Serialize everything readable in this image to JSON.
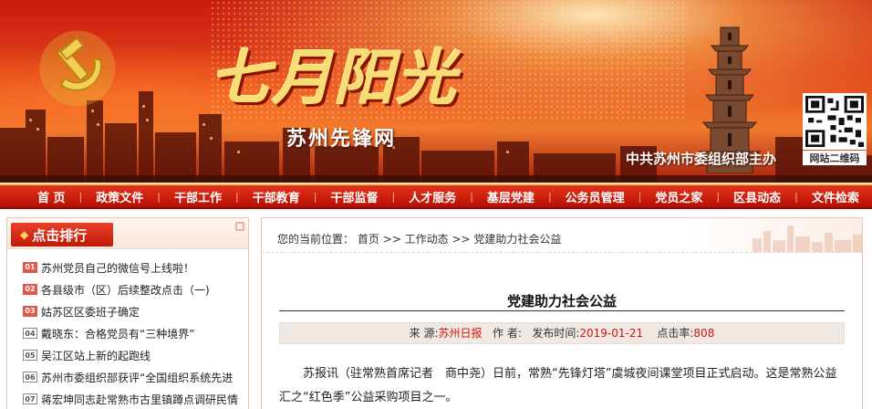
{
  "banner": {
    "title": "七月阳光",
    "subtitle": "苏州先锋网",
    "sponsor": "中共苏州市委组织部主办",
    "qr_label": "网站二维码"
  },
  "nav": {
    "items": [
      {
        "label": "首 页"
      },
      {
        "label": "政策文件"
      },
      {
        "label": "干部工作"
      },
      {
        "label": "干部教育"
      },
      {
        "label": "干部监督"
      },
      {
        "label": "人才服务"
      },
      {
        "label": "基层党建"
      },
      {
        "label": "公务员管理"
      },
      {
        "label": "党员之家"
      },
      {
        "label": "区县动态"
      },
      {
        "label": "文件检索"
      }
    ]
  },
  "ranking": {
    "title": "点击排行",
    "items": [
      {
        "num": "01",
        "hot": true,
        "text": "苏州党员自己的微信号上线啦！"
      },
      {
        "num": "02",
        "hot": true,
        "text": "各县级市（区）后续整改点击（一)"
      },
      {
        "num": "03",
        "hot": true,
        "text": "姑苏区区委班子确定"
      },
      {
        "num": "04",
        "hot": false,
        "text": "戴晓东：合格党员有“三种境界”"
      },
      {
        "num": "05",
        "hot": false,
        "text": "吴江区站上新的起跑线"
      },
      {
        "num": "06",
        "hot": false,
        "text": "苏州市委组织部获评“全国组织系统先进"
      },
      {
        "num": "07",
        "hot": false,
        "text": "蒋宏坤同志赴常熟市古里镇蹲点调研民情"
      }
    ]
  },
  "breadcrumb": {
    "prefix": "您的当前位置：",
    "home": "首页",
    "sep": ">>",
    "section": "工作动态",
    "current": "党建助力社会公益"
  },
  "article": {
    "title": "党建助力社会公益",
    "source_label": "来 源:",
    "source": "苏州日报",
    "author_label": "作 者:",
    "author": "",
    "date_label": "发布时间:",
    "date": "2019-01-21",
    "hits_label": "点击率:",
    "hits": "808",
    "body": "苏报讯（驻常熟首席记者　商中尧）日前，常熟“先锋灯塔”虞城夜间课堂项目正式启动。这是常熟公益汇之“红色季”公益采购项目之一。"
  },
  "colors": {
    "nav_red": "#c41a0a",
    "accent_red": "#d3160a",
    "title_gold": "#f7dd73"
  }
}
